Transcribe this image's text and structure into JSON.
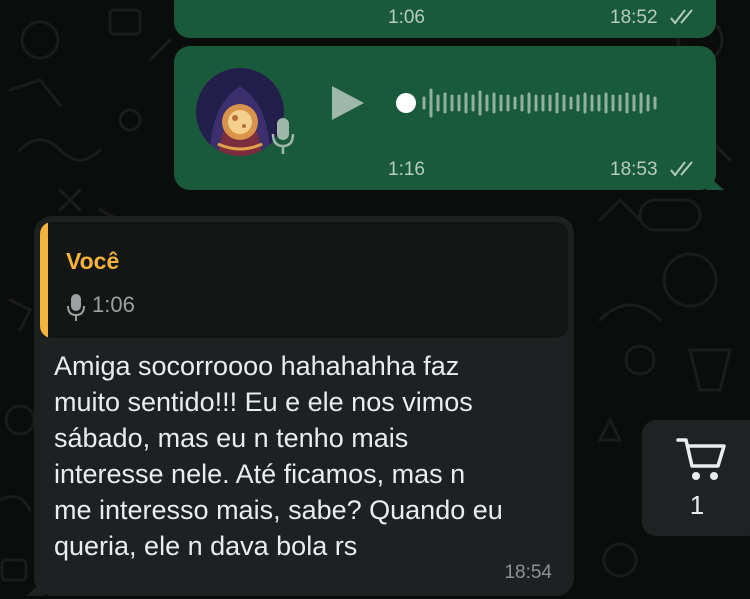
{
  "chat": {
    "outgoing": [
      {
        "duration": "1:06",
        "time": "18:52"
      },
      {
        "duration": "1:16",
        "time": "18:53",
        "avatar_icon": "fortune-teller-avatar"
      }
    ],
    "incoming": {
      "reply_to": {
        "author": "Você",
        "duration": "1:06"
      },
      "text": "Amiga socorroooo hahahahha faz\nmuito sentido!!! Eu e ele nos vimos\nsábado, mas eu n tenho mais\ninteresse nele. Até ficamos, mas n\nme interesso mais, sabe? Quando eu\nqueria, ele n dava bola rs",
      "time": "18:54"
    }
  },
  "cart": {
    "count": "1"
  },
  "colors": {
    "outgoing_bubble": "#1a5a3c",
    "incoming_bubble": "#1f2021",
    "quote_accent": "#f3b33d",
    "background": "#0b0c0c"
  }
}
